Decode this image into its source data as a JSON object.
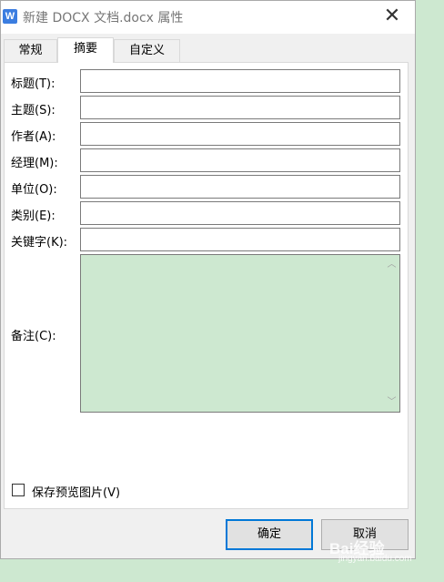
{
  "window": {
    "icon_letter": "W",
    "title": "新建 DOCX 文档.docx 属性",
    "close_glyph": "✕"
  },
  "tabs": [
    {
      "label": "常规",
      "active": false
    },
    {
      "label": "摘要",
      "active": true
    },
    {
      "label": "自定义",
      "active": false
    }
  ],
  "fields": [
    {
      "label": "标题(T):",
      "value": ""
    },
    {
      "label": "主题(S):",
      "value": ""
    },
    {
      "label": "作者(A):",
      "value": ""
    },
    {
      "label": "经理(M):",
      "value": ""
    },
    {
      "label": "单位(O):",
      "value": ""
    },
    {
      "label": "类别(E):",
      "value": ""
    },
    {
      "label": "关键字(K):",
      "value": ""
    }
  ],
  "comments": {
    "label": "备注(C):",
    "value": "",
    "scroll_up_glyph": "︿",
    "scroll_down_glyph": "﹀"
  },
  "save_preview": {
    "label": "保存预览图片(V)",
    "checked": false
  },
  "buttons": {
    "ok": "确定",
    "cancel": "取消"
  },
  "watermark": {
    "text": "Bai经验",
    "sub": "jingyan.baidu.com"
  },
  "colors": {
    "accent": "#0078d7",
    "comments_bg": "#cde8d0",
    "app_icon": "#3b7de0"
  }
}
